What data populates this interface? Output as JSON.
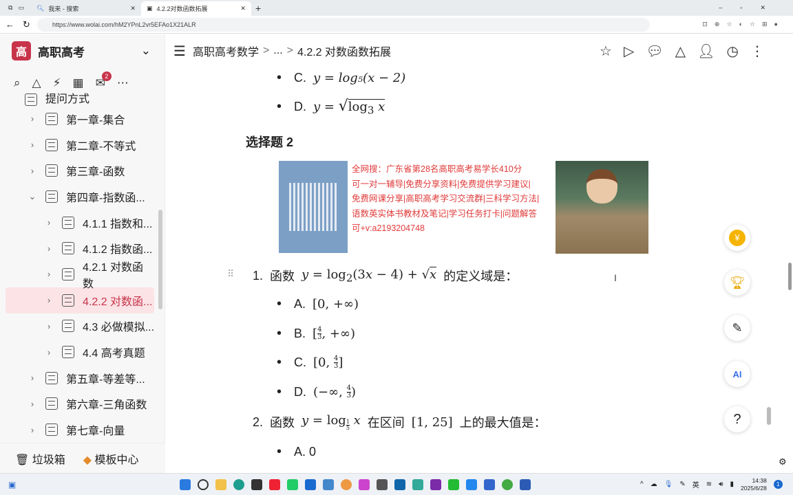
{
  "browser": {
    "tabs": [
      {
        "title": "我来 - 搜索"
      },
      {
        "title": "4.2.2对数函数拓展"
      }
    ],
    "url": "https://www.wolai.com/hM2YPnL2vr5EFAo1X21ALR"
  },
  "sidebar": {
    "workspace_logo": "高",
    "workspace": "高职高考",
    "badge": "2",
    "items": [
      {
        "label": "提问方式",
        "level": 0
      },
      {
        "label": "第一章-集合",
        "level": 0
      },
      {
        "label": "第二章-不等式",
        "level": 0
      },
      {
        "label": "第三章-函数",
        "level": 0
      },
      {
        "label": "第四章-指数函...",
        "level": 0,
        "open": true
      },
      {
        "label": "4.1.1 指数和...",
        "level": 1
      },
      {
        "label": "4.1.2 指数函...",
        "level": 1
      },
      {
        "label": "4.2.1 对数函数",
        "level": 1
      },
      {
        "label": "4.2.2 对数函...",
        "level": 1,
        "selected": true
      },
      {
        "label": "4.3 必做模拟...",
        "level": 1
      },
      {
        "label": "4.4 高考真题",
        "level": 1
      },
      {
        "label": "第五章-等差等...",
        "level": 0
      },
      {
        "label": "第六章-三角函数",
        "level": 0
      },
      {
        "label": "第七章-向量",
        "level": 0
      }
    ],
    "trash": "垃圾箱",
    "templates": "模板中心"
  },
  "header": {
    "crumb1": "高职高考数学",
    "sep": ">",
    "ellipsis": "...",
    "crumb2": "4.2.2 对数函数拓展"
  },
  "content": {
    "prev_c_label": "C.",
    "prev_c": "y = log₅(x − 2)",
    "prev_d_label": "D.",
    "heading": "选择题 2",
    "ad_lines": [
      "全网搜：广东省第28名高职高考易学长410分",
      "可一对一辅导|免费分享资料|免费提供学习建议|",
      "免费网课分享|高职高考学习交流群|三科学习方法|",
      "语数英实体书教材及笔记|学习任务打卡|问题解答",
      "可+v:a2193204748"
    ],
    "q1_num": "1.",
    "q1_pre": "函数",
    "q1_post": "的定义域是：",
    "q1_opts": [
      {
        "label": "A."
      },
      {
        "label": "B."
      },
      {
        "label": "C."
      },
      {
        "label": "D."
      }
    ],
    "q2_num": "2.",
    "q2_pre": "函数",
    "q2_mid": "在区间",
    "q2_interval": "[1, 25]",
    "q2_post": "上的最大值是：",
    "q2_a": "A. 0"
  },
  "taskbar": {
    "ime": "英",
    "time": "14:38",
    "date": "2025/6/28",
    "notif": "1"
  },
  "colors": {
    "accent": "#c8344a",
    "ad_text": "#e03a3a"
  }
}
